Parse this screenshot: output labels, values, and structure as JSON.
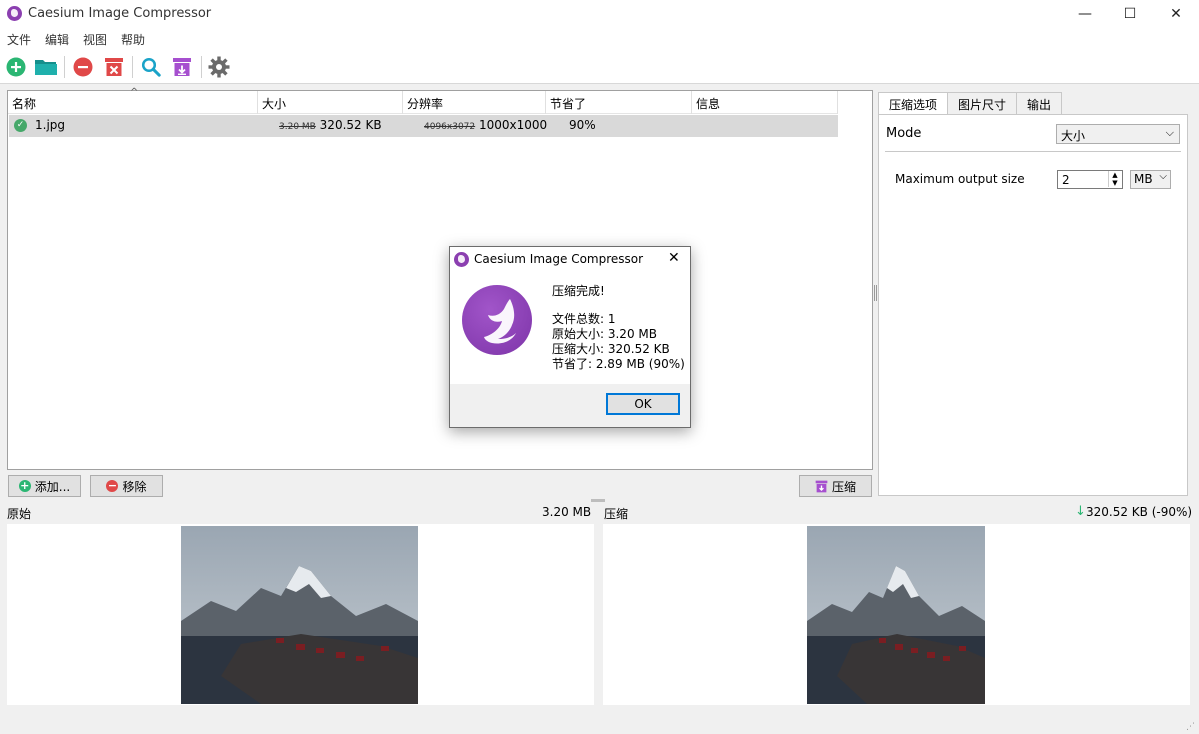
{
  "window": {
    "title": "Caesium Image Compressor",
    "minimize_glyph": "—",
    "maximize_glyph": "☐",
    "close_glyph": "✕"
  },
  "menu": [
    "文件",
    "编辑",
    "视图",
    "帮助"
  ],
  "toolbar": {
    "icons": [
      "add-icon",
      "open-folder-icon",
      "remove-icon",
      "clear-list-icon",
      "preview-search-icon",
      "compress-icon",
      "settings-icon"
    ]
  },
  "table": {
    "columns": [
      "名称",
      "大小",
      "分辨率",
      "节省了",
      "信息"
    ],
    "rows": [
      {
        "name": "1.jpg",
        "size_original": "3.20 MB",
        "size_compressed": "320.52 KB",
        "resolution_original": "4096x3072",
        "resolution_compressed": "1000x1000",
        "saved": "90%",
        "info": ""
      }
    ]
  },
  "buttons": {
    "add": "添加...",
    "remove": "移除",
    "compress": "压缩"
  },
  "right_panel": {
    "tabs": [
      "压缩选项",
      "图片尺寸",
      "输出"
    ],
    "mode_label": "Mode",
    "mode_value": "大小",
    "max_output_label": "Maximum output size",
    "max_output_value": "2",
    "unit_value": "MB"
  },
  "preview": {
    "original_label": "原始",
    "original_size": "3.20 MB",
    "compressed_label": "压缩",
    "compressed_size": "320.52 KB (-90%)"
  },
  "dialog": {
    "title": "Caesium Image Compressor",
    "heading": "压缩完成!",
    "total_files": "文件总数: 1",
    "original_size": "原始大小: 3.20 MB",
    "compressed_size": "压缩大小: 320.52 KB",
    "saved": "节省了: 2.89 MB (90%)",
    "ok": "OK"
  },
  "colors": {
    "accent_purple": "#8b3fb0",
    "add_green": "#2bb673",
    "folder_teal": "#1aa3a0",
    "remove_red": "#e04848"
  }
}
